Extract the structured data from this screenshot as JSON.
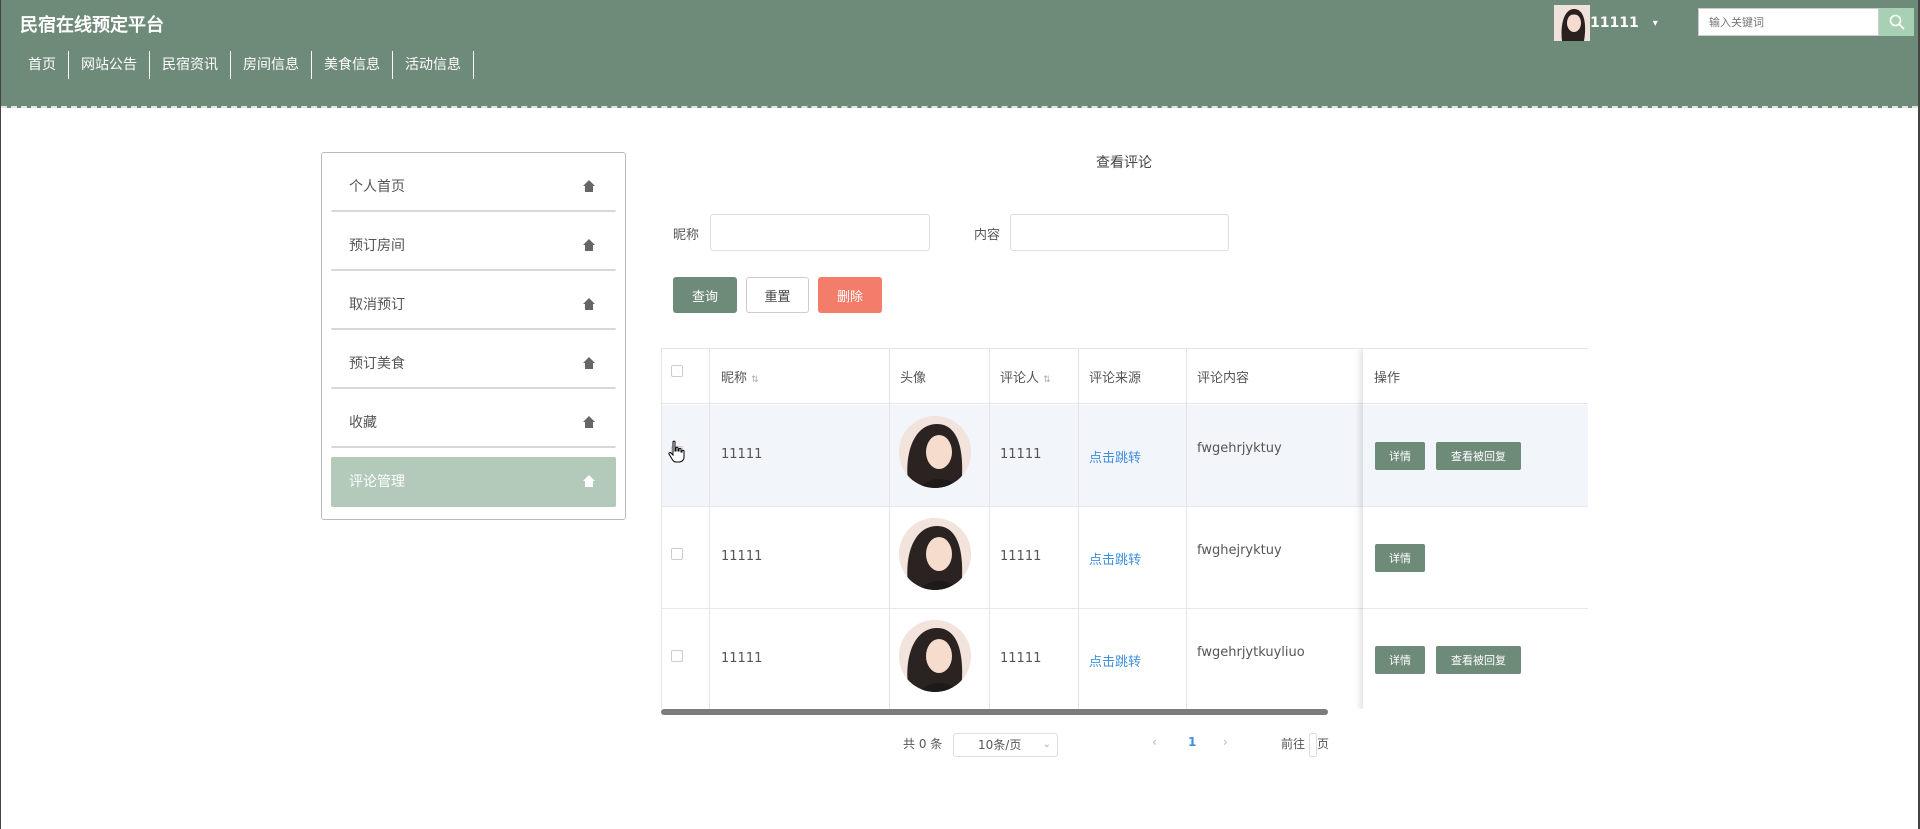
{
  "header": {
    "brand": "民宿在线预定平台",
    "nav": [
      "首页",
      "网站公告",
      "民宿资讯",
      "房间信息",
      "美食信息",
      "活动信息"
    ],
    "username": "11111",
    "search_placeholder": "输入关键词"
  },
  "sidebar": {
    "items": [
      "个人首页",
      "预订房间",
      "取消预订",
      "预订美食",
      "收藏",
      "评论管理"
    ],
    "active_index": 5
  },
  "main": {
    "title": "查看评论",
    "filter": {
      "nickname_label": "昵称",
      "content_label": "内容"
    },
    "buttons": {
      "query": "查询",
      "reset": "重置",
      "delete": "删除"
    }
  },
  "table": {
    "headers": {
      "nickname": "昵称",
      "avatar": "头像",
      "commenter": "评论人",
      "source": "评论来源",
      "content": "评论内容",
      "actions": "操作"
    },
    "rows": [
      {
        "nickname": "11111",
        "commenter": "11111",
        "source": "点击跳转",
        "content": "fwgehrjyktuy",
        "detail": "详情",
        "reply": "查看被回复"
      },
      {
        "nickname": "11111",
        "commenter": "11111",
        "source": "点击跳转",
        "content": "fwghejryktuy",
        "detail": "详情"
      },
      {
        "nickname": "11111",
        "commenter": "11111",
        "source": "点击跳转",
        "content": "fwgehrjytkuyliuo",
        "detail": "详情",
        "reply": "查看被回复"
      }
    ]
  },
  "pagination": {
    "total": "共 0 条",
    "page_size": "10条/页",
    "current_page": "1",
    "goto_prefix": "前往",
    "goto_suffix": "页"
  },
  "colors": {
    "header": "#6e8a78",
    "sidebar_active": "#b3c9b9",
    "delete": "#f37c6b",
    "link": "#3e8fe0"
  }
}
